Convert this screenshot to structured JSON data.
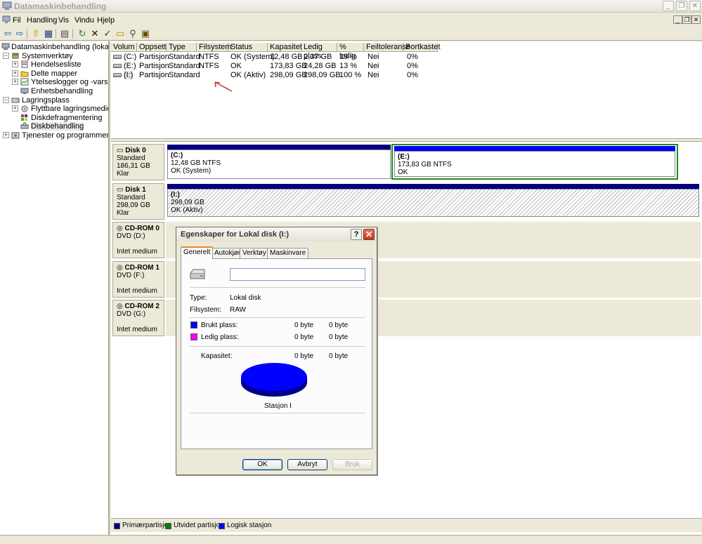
{
  "window": {
    "title": "Datamaskinbehandling"
  },
  "menu": {
    "items": [
      "Fil",
      "Handling",
      "Vis",
      "Vindu",
      "Hjelp"
    ]
  },
  "tree": {
    "root": "Datamaskinbehandling (lokal)",
    "system_tools": "Systemverktøy",
    "event_viewer": "Hendelsesliste",
    "shared_folders": "Delte mapper",
    "perf_logs": "Ytelseslogger og -varsler",
    "device_manager": "Enhetsbehandling",
    "storage": "Lagringsplass",
    "removable": "Flyttbare lagringsmedier",
    "defrag": "Diskdefragmentering",
    "disk_mgmt": "Diskbehandling",
    "services": "Tjenester og programmer"
  },
  "volume_table": {
    "headers": [
      "Volum",
      "Oppsett",
      "Type",
      "Filsystem",
      "Status",
      "Kapasitet",
      "Ledig plass",
      "% ledig",
      "Feiltoleranse",
      "Bortkastet"
    ],
    "rows": [
      [
        "(C:)",
        "Partisjon",
        "Standard",
        "NTFS",
        "OK (System)",
        "12,48 GB",
        "2,37 GB",
        "19 %",
        "Nei",
        "0%"
      ],
      [
        "(E:)",
        "Partisjon",
        "Standard",
        "NTFS",
        "OK",
        "173,83 GB",
        "24,28 GB",
        "13 %",
        "Nei",
        "0%"
      ],
      [
        "(I:)",
        "Partisjon",
        "Standard",
        "",
        "OK (Aktiv)",
        "298,09 GB",
        "298,09 GB",
        "100 %",
        "Nei",
        "0%"
      ]
    ]
  },
  "disks": {
    "disk0": {
      "name": "Disk 0",
      "type": "Standard",
      "size": "186,31 GB",
      "state": "Klar"
    },
    "disk0_c": {
      "letter": "(C:)",
      "size": "12,48 GB NTFS",
      "status": "OK (System)"
    },
    "disk0_e": {
      "letter": "(E:)",
      "size": "173,83 GB NTFS",
      "status": "OK"
    },
    "disk1": {
      "name": "Disk 1",
      "type": "Standard",
      "size": "298,09 GB",
      "state": "Klar"
    },
    "disk1_i": {
      "letter": "(I:)",
      "size": "298,09 GB",
      "status": "OK (Aktiv)"
    },
    "cd0": {
      "name": "CD-ROM 0",
      "type": "DVD (D:)",
      "state": "Intet medium"
    },
    "cd1": {
      "name": "CD-ROM 1",
      "type": "DVD (F:)",
      "state": "Intet medium"
    },
    "cd2": {
      "name": "CD-ROM 2",
      "type": "DVD (G:)",
      "state": "Intet medium"
    }
  },
  "legend": {
    "primary": "Primærpartisjon",
    "extended": "Utvidet partisjon",
    "logical": "Logisk stasjon",
    "colors": {
      "primary": "#000080",
      "extended": "#008000",
      "logical": "#0000ff"
    }
  },
  "dialog": {
    "title": "Egenskaper for Lokal disk (I:)",
    "tabs": [
      "Generelt",
      "Autokjør",
      "Verktøy",
      "Maskinvare"
    ],
    "name_value": "",
    "type_label": "Type:",
    "type_value": "Lokal disk",
    "fs_label": "Filsystem:",
    "fs_value": "RAW",
    "used_label": "Brukt plass:",
    "used_bytes": "0 byte",
    "used_size": "0 byte",
    "free_label": "Ledig plass:",
    "free_bytes": "0 byte",
    "free_size": "0 byte",
    "cap_label": "Kapasitet:",
    "cap_bytes": "0 byte",
    "cap_size": "0 byte",
    "drive_label": "Stasjon I",
    "ok": "OK",
    "cancel": "Avbryt",
    "apply": "Bruk",
    "colors": {
      "used": "#0000ff",
      "free": "#ff00ff"
    }
  }
}
